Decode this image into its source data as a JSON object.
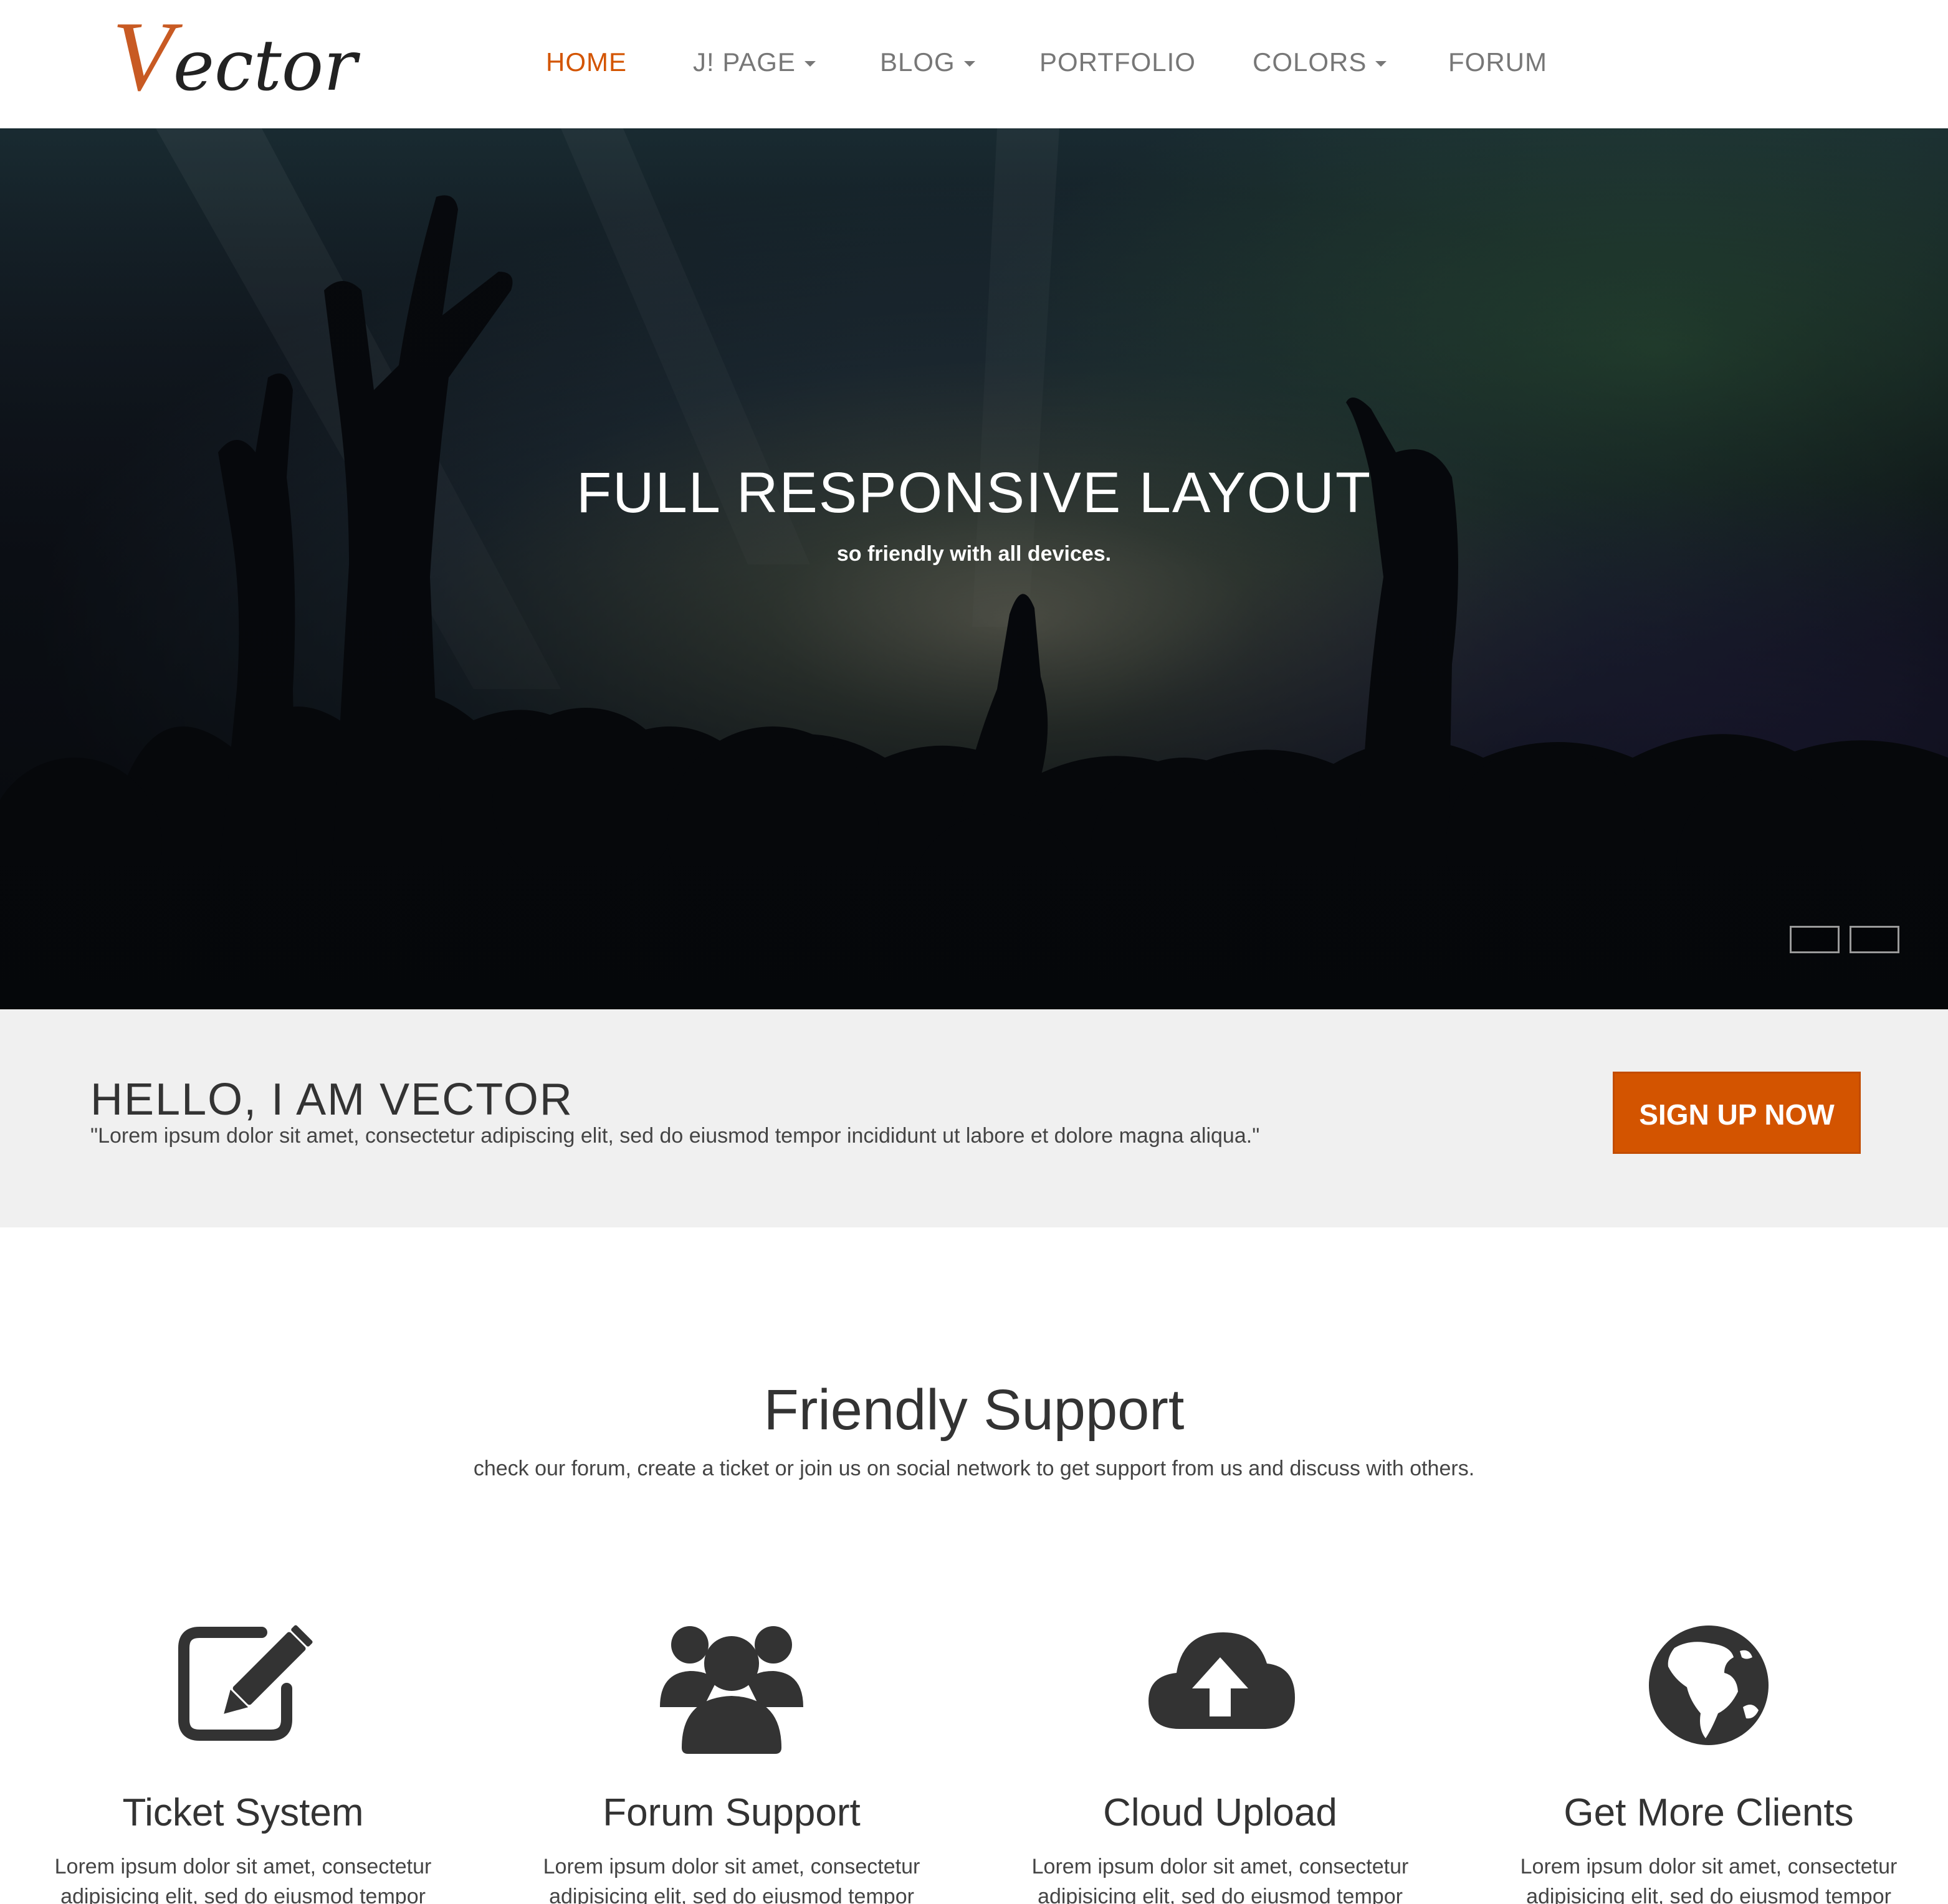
{
  "header": {
    "logo_initial": "V",
    "logo_rest": "ector",
    "nav": [
      {
        "label": "HOME",
        "active": true,
        "dropdown": false
      },
      {
        "label": "J! PAGE",
        "active": false,
        "dropdown": true
      },
      {
        "label": "BLOG",
        "active": false,
        "dropdown": true
      },
      {
        "label": "PORTFOLIO",
        "active": false,
        "dropdown": false
      },
      {
        "label": "COLORS",
        "active": false,
        "dropdown": true
      },
      {
        "label": "FORUM",
        "active": false,
        "dropdown": false
      }
    ]
  },
  "hero": {
    "title": "FULL RESPONSIVE LAYOUT",
    "subtitle": "so friendly with all devices.",
    "slides": 2
  },
  "intro": {
    "title": "HELLO, I AM VECTOR",
    "text": "\"Lorem ipsum dolor sit amet, consectetur adipiscing elit, sed do eiusmod tempor incididunt ut labore et dolore magna aliqua.\"",
    "button_label": "SIGN UP NOW"
  },
  "support": {
    "title": "Friendly Support",
    "subtitle": "check our forum, create a ticket or join us on social network to get support from us and discuss with others.",
    "features": [
      {
        "icon": "edit-icon",
        "title": "Ticket System",
        "text": "Lorem ipsum dolor sit amet, consectetur adipisicing elit, sed do eiusmod tempor"
      },
      {
        "icon": "users-icon",
        "title": "Forum Support",
        "text": "Lorem ipsum dolor sit amet, consectetur adipisicing elit, sed do eiusmod tempor"
      },
      {
        "icon": "cloud-upload-icon",
        "title": "Cloud Upload",
        "text": "Lorem ipsum dolor sit amet, consectetur adipisicing elit, sed do eiusmod tempor"
      },
      {
        "icon": "globe-icon",
        "title": "Get More Clients",
        "text": "Lorem ipsum dolor sit amet, consectetur adipisicing elit, sed do eiusmod tempor"
      }
    ]
  },
  "colors": {
    "accent": "#d35400",
    "nav_text": "#777777",
    "band_bg": "#f0f0f0",
    "icon": "#333333"
  }
}
